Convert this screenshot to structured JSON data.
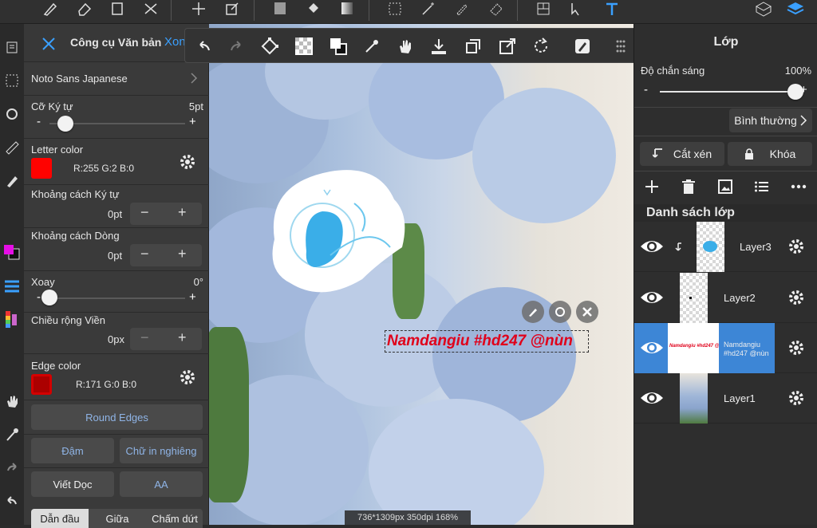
{
  "colors": {
    "accent": "#3aa0ff",
    "letter_color": "#ff0200",
    "edge_color": "#ab0000",
    "text_fill": "#e0001a",
    "selected_layer": "#3d86d6"
  },
  "text_panel": {
    "title": "Công cụ Văn bản",
    "done_label": "Xon",
    "font_name": "Noto Sans Japanese",
    "font_size": {
      "label": "Cỡ Ký tự",
      "value": "5pt",
      "level": 0.12
    },
    "letter_color": {
      "label": "Letter color",
      "value": "R:255 G:2 B:0"
    },
    "char_spacing": {
      "label": "Khoảng cách Ký tự",
      "value": "0pt"
    },
    "line_spacing": {
      "label": "Khoảng cách Dòng",
      "value": "0pt"
    },
    "rotation": {
      "label": "Xoay",
      "value": "0°",
      "level": 0.0
    },
    "edge_width": {
      "label": "Chiều rộng Viền",
      "value": "0px"
    },
    "edge_color": {
      "label": "Edge color",
      "value": "R:171 G:0 B:0"
    },
    "round_edges": "Round Edges",
    "bold": "Đậm",
    "italic": "Chữ in nghiêng",
    "vertical": "Viết Dọc",
    "aa": "AA",
    "align": [
      "Dẫn đầu",
      "Giữa",
      "Chấm dứt"
    ]
  },
  "canvas": {
    "text_object": "Namdangiu #hd247 @nùn",
    "status": "736*1309px 350dpi 168%"
  },
  "layer_panel": {
    "title": "Lớp",
    "opacity_label": "Độ chắn sáng",
    "opacity_value": "100%",
    "opacity_level": 1.0,
    "blend_mode": "Bình thường",
    "clip_label": "Cắt xén",
    "lock_label": "Khóa",
    "list_title": "Danh sách lớp",
    "layers": [
      {
        "name": "Layer3"
      },
      {
        "name": "Layer2"
      },
      {
        "name": "Namdangiu #hd247 @nùn",
        "selected": true
      },
      {
        "name": "Layer1"
      }
    ]
  }
}
